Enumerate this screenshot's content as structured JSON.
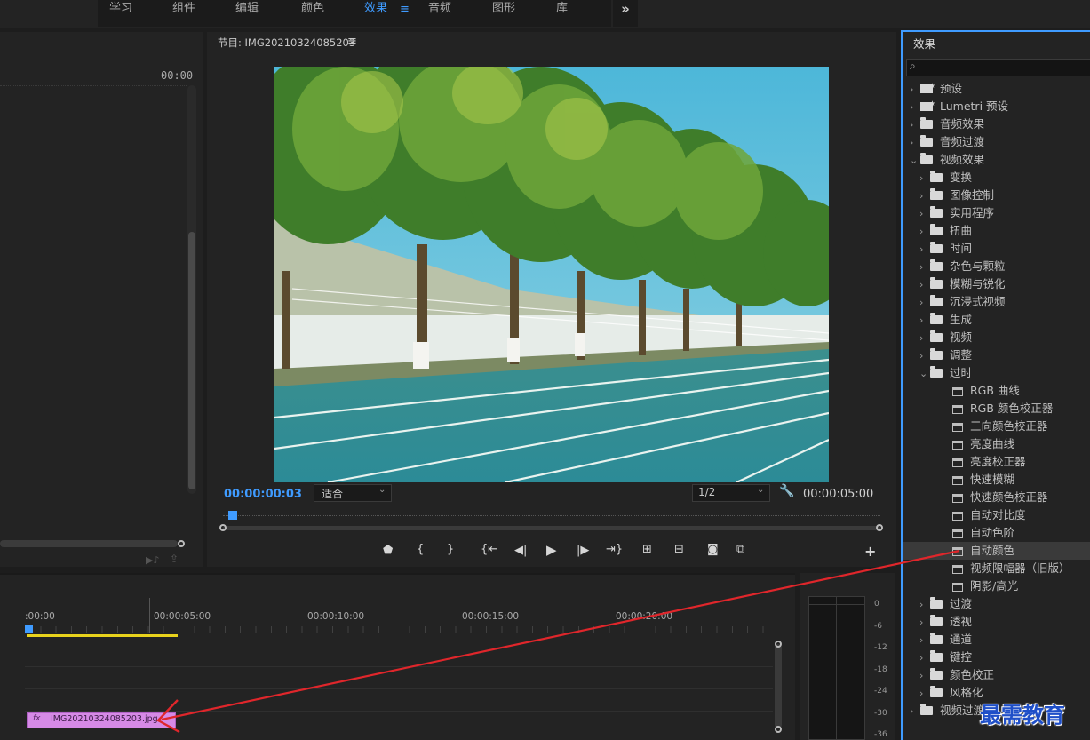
{
  "workspaces": {
    "tabs": [
      "学习",
      "组件",
      "编辑",
      "颜色",
      "效果",
      "音频",
      "图形",
      "库"
    ],
    "active": "效果",
    "more": "»",
    "menu_glyph": "≡"
  },
  "source_panel": {
    "timecode": "00:00"
  },
  "program": {
    "title": "节目: IMG20210324085203",
    "menu_glyph": "≡",
    "current_time": "00:00:00:03",
    "fit": "适合",
    "resolution": "1/2",
    "duration": "00:00:05:00",
    "add": "+"
  },
  "effects": {
    "title": "效果",
    "search_placeholder": "",
    "items": [
      {
        "label": "预设",
        "kind": "preset",
        "level": 0,
        "chev": "›"
      },
      {
        "label": "Lumetri 预设",
        "kind": "preset",
        "level": 0,
        "chev": "›"
      },
      {
        "label": "音频效果",
        "kind": "folder",
        "level": 0,
        "chev": "›"
      },
      {
        "label": "音频过渡",
        "kind": "folder",
        "level": 0,
        "chev": "›"
      },
      {
        "label": "视频效果",
        "kind": "folder",
        "level": 0,
        "chev": "⌄"
      },
      {
        "label": "变换",
        "kind": "folder",
        "level": 1,
        "chev": "›"
      },
      {
        "label": "图像控制",
        "kind": "folder",
        "level": 1,
        "chev": "›"
      },
      {
        "label": "实用程序",
        "kind": "folder",
        "level": 1,
        "chev": "›"
      },
      {
        "label": "扭曲",
        "kind": "folder",
        "level": 1,
        "chev": "›"
      },
      {
        "label": "时间",
        "kind": "folder",
        "level": 1,
        "chev": "›"
      },
      {
        "label": "杂色与颗粒",
        "kind": "folder",
        "level": 1,
        "chev": "›"
      },
      {
        "label": "模糊与锐化",
        "kind": "folder",
        "level": 1,
        "chev": "›"
      },
      {
        "label": "沉浸式视频",
        "kind": "folder",
        "level": 1,
        "chev": "›"
      },
      {
        "label": "生成",
        "kind": "folder",
        "level": 1,
        "chev": "›"
      },
      {
        "label": "视频",
        "kind": "folder",
        "level": 1,
        "chev": "›"
      },
      {
        "label": "调整",
        "kind": "folder",
        "level": 1,
        "chev": "›"
      },
      {
        "label": "过时",
        "kind": "folder",
        "level": 1,
        "chev": "⌄"
      },
      {
        "label": "RGB 曲线",
        "kind": "effect",
        "level": 2,
        "chev": ""
      },
      {
        "label": "RGB 颜色校正器",
        "kind": "effect",
        "level": 2,
        "chev": ""
      },
      {
        "label": "三向颜色校正器",
        "kind": "effect",
        "level": 2,
        "chev": ""
      },
      {
        "label": "亮度曲线",
        "kind": "effect",
        "level": 2,
        "chev": ""
      },
      {
        "label": "亮度校正器",
        "kind": "effect",
        "level": 2,
        "chev": ""
      },
      {
        "label": "快速模糊",
        "kind": "effect",
        "level": 2,
        "chev": ""
      },
      {
        "label": "快速颜色校正器",
        "kind": "effect",
        "level": 2,
        "chev": ""
      },
      {
        "label": "自动对比度",
        "kind": "effect",
        "level": 2,
        "chev": ""
      },
      {
        "label": "自动色阶",
        "kind": "effect",
        "level": 2,
        "chev": ""
      },
      {
        "label": "自动颜色",
        "kind": "effect",
        "level": 2,
        "chev": "",
        "selected": true
      },
      {
        "label": "视频限幅器（旧版）",
        "kind": "effect",
        "level": 2,
        "chev": ""
      },
      {
        "label": "阴影/高光",
        "kind": "effect",
        "level": 2,
        "chev": ""
      },
      {
        "label": "过渡",
        "kind": "folder",
        "level": 1,
        "chev": "›"
      },
      {
        "label": "透视",
        "kind": "folder",
        "level": 1,
        "chev": "›"
      },
      {
        "label": "通道",
        "kind": "folder",
        "level": 1,
        "chev": "›"
      },
      {
        "label": "键控",
        "kind": "folder",
        "level": 1,
        "chev": "›"
      },
      {
        "label": "颜色校正",
        "kind": "folder",
        "level": 1,
        "chev": "›"
      },
      {
        "label": "风格化",
        "kind": "folder",
        "level": 1,
        "chev": "›"
      },
      {
        "label": "视频过渡",
        "kind": "folder",
        "level": 0,
        "chev": "›"
      }
    ]
  },
  "timeline": {
    "ruler": [
      ":00:00",
      "00:00:05:00",
      "00:00:10:00",
      "00:00:15:00",
      "00:00:20:00"
    ],
    "clip": {
      "fx": "fx",
      "name": "IMG20210324085203.jpg"
    }
  },
  "meter": {
    "ticks": [
      "0",
      "-6",
      "-12",
      "-18",
      "-24",
      "-30",
      "-36"
    ]
  },
  "watermark": "最需教育",
  "colors": {
    "accent": "#3f9bff",
    "clip": "#d68ae6",
    "arrow": "#e0262b",
    "yellow": "#e8d21c"
  }
}
